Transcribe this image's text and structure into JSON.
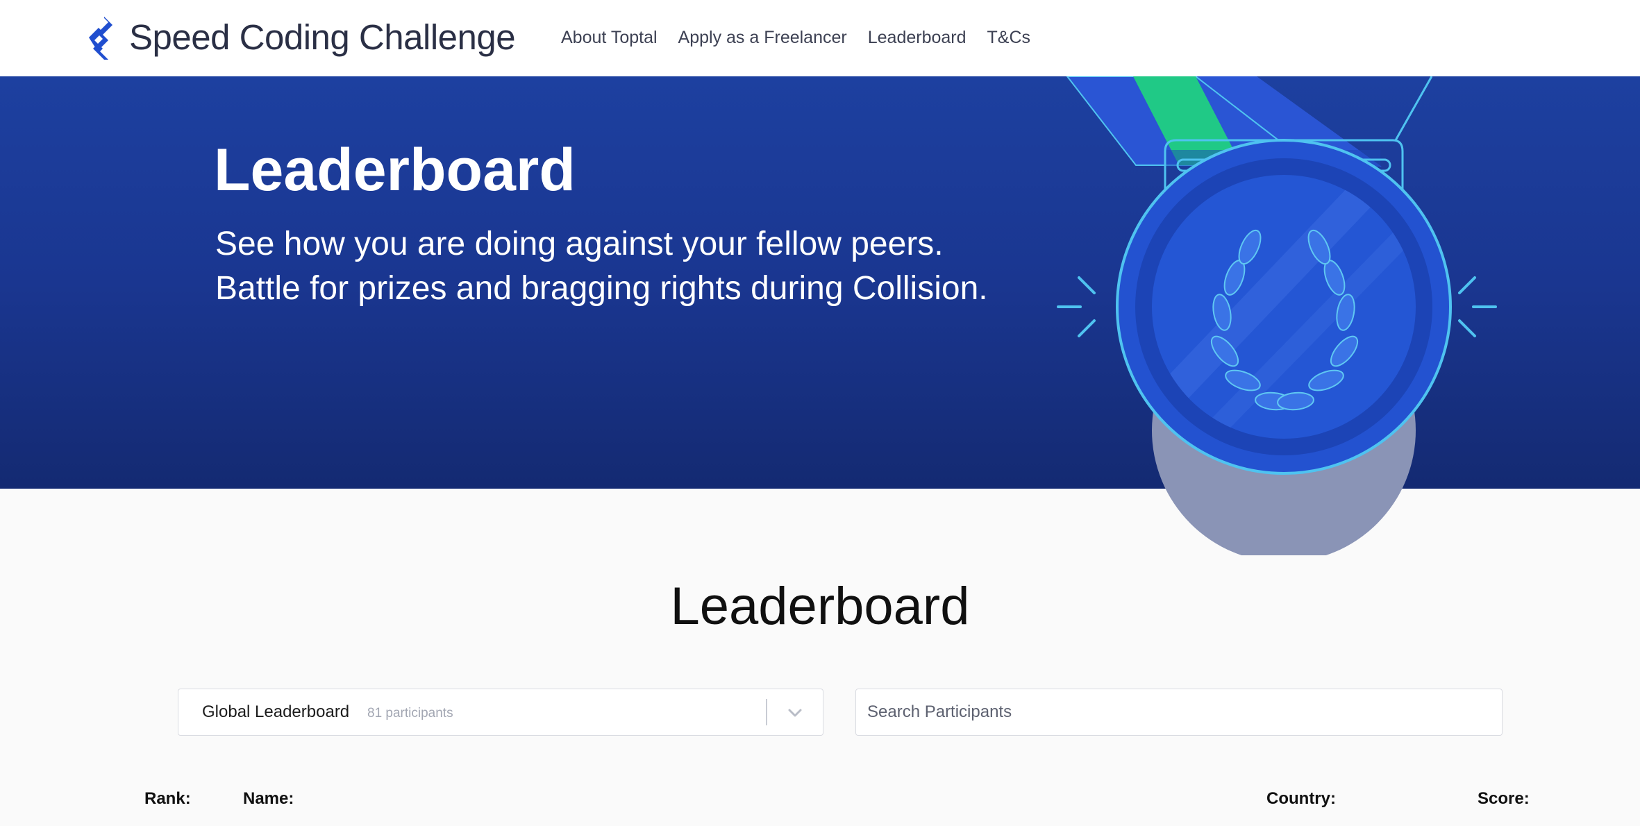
{
  "brand": {
    "title": "Speed Coding Challenge"
  },
  "nav": {
    "links": [
      "About Toptal",
      "Apply as a Freelancer",
      "Leaderboard",
      "T&Cs"
    ]
  },
  "hero": {
    "title": "Leaderboard",
    "subtitle_line1": "See how you are doing against your fellow peers.",
    "subtitle_line2": "Battle for prizes and bragging rights during Collision."
  },
  "leaderboard": {
    "title": "Leaderboard",
    "select": {
      "label": "Global Leaderboard",
      "count": "81 participants"
    },
    "search": {
      "placeholder": "Search Participants"
    },
    "columns": {
      "rank": "Rank:",
      "name": "Name:",
      "country": "Country:",
      "score": "Score:"
    }
  },
  "colors": {
    "brand_blue": "#204ECF",
    "hero_top": "#1d40a0",
    "hero_bottom": "#142a72",
    "ribbon_green": "#20c986",
    "medal_outline": "#4fc3f0"
  },
  "icons": {
    "logo": "toptal-logo-icon",
    "medal": "medal-illustration",
    "chevron": "chevron-down-icon"
  }
}
